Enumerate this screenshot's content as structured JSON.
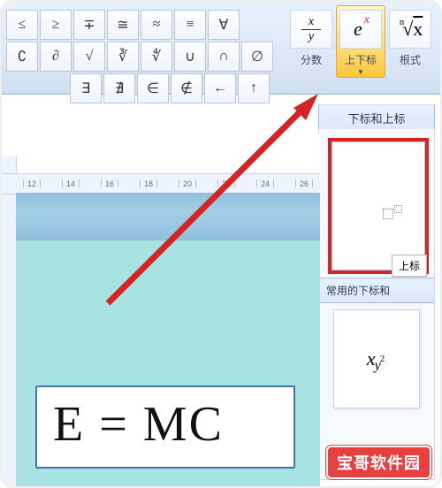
{
  "symbols": {
    "row1": [
      "≤",
      "≥",
      "∓",
      "≅",
      "≈",
      "≡",
      "∀"
    ],
    "row2": [
      "∁",
      "∂",
      "√",
      "∛",
      "∜",
      "∪",
      "∩",
      "∅"
    ],
    "row3_start": 2,
    "row3": [
      "∃",
      "∄",
      "∈",
      "∉",
      "←",
      "↑"
    ]
  },
  "ribbon": {
    "buttons": [
      {
        "key": "fraction",
        "label": "分数",
        "glyph": "xy_frac"
      },
      {
        "key": "script",
        "label": "上下标",
        "glyph": "ex",
        "dropdown": true,
        "selected": true
      },
      {
        "key": "radical",
        "label": "根式",
        "glyph": "rad"
      }
    ]
  },
  "gallery": {
    "title": "下标和上标",
    "tooltip": "上标",
    "section2": "常用的下标和",
    "item2_text": {
      "x": "x",
      "y": "y",
      "p": "2"
    }
  },
  "ruler": {
    "marks": [
      "12",
      "14",
      "16",
      "18",
      "20",
      "22",
      "24",
      "26"
    ]
  },
  "equation": "E = MC",
  "badge": "宝哥软件园"
}
